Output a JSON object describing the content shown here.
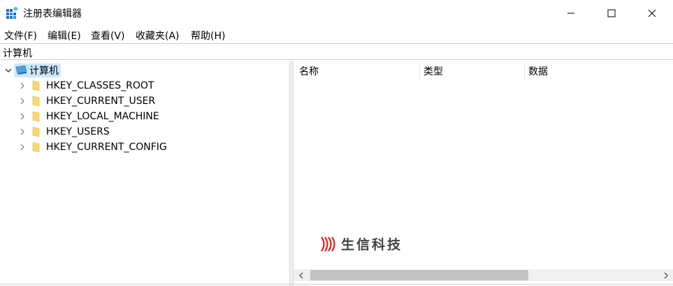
{
  "window": {
    "title": "注册表编辑器"
  },
  "menu": [
    "文件(F)",
    "编辑(E)",
    "查看(V)",
    "收藏夹(A)",
    "帮助(H)"
  ],
  "address": "计算机",
  "tree": {
    "root": "计算机",
    "keys": [
      "HKEY_CLASSES_ROOT",
      "HKEY_CURRENT_USER",
      "HKEY_LOCAL_MACHINE",
      "HKEY_USERS",
      "HKEY_CURRENT_CONFIG"
    ]
  },
  "columns": [
    "名称",
    "类型",
    "数据"
  ],
  "watermark": "生信科技",
  "colors": {
    "selection": "#cce8ff",
    "folder": "#f8d775",
    "watermark_red": "#e02020"
  }
}
